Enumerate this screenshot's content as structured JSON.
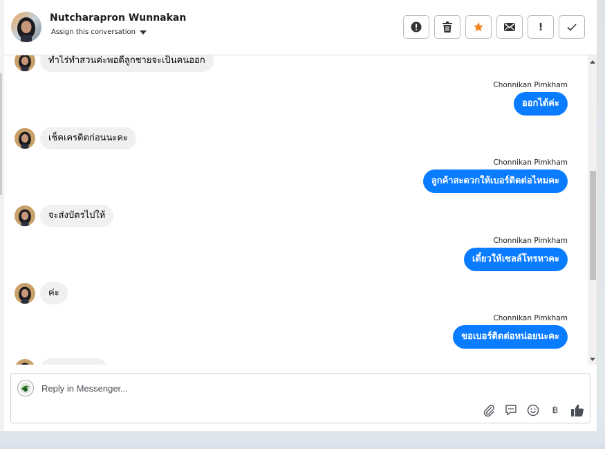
{
  "header": {
    "contact_name": "Nutcharapron Wunnakan",
    "assign_label": "Assign this conversation",
    "actions": [
      {
        "name": "spam",
        "icon": "alert-circle-icon"
      },
      {
        "name": "delete",
        "icon": "trash-icon"
      },
      {
        "name": "star",
        "icon": "star-icon",
        "color": "#f5821f"
      },
      {
        "name": "mark-unread",
        "icon": "envelope-icon"
      },
      {
        "name": "follow-up",
        "icon": "exclamation-icon",
        "glyph": "!"
      },
      {
        "name": "done",
        "icon": "check-icon"
      }
    ]
  },
  "messages": [
    {
      "direction": "in",
      "text": "ทำไร่ทำสวนค่ะพอดีลูกชายจะเป็นคนออก"
    },
    {
      "direction": "out",
      "sender": "Chonnikan Pimkham",
      "text": "ออกได้ค่ะ"
    },
    {
      "direction": "in",
      "text": "เช็คเครดิตก่อนนะคะ"
    },
    {
      "direction": "out",
      "sender": "Chonnikan Pimkham",
      "text": "ลูกค้าสะดวกให้เบอร์ติดต่อไหมคะ"
    },
    {
      "direction": "in",
      "text": "จะส่งบัตรไปให้"
    },
    {
      "direction": "out",
      "sender": "Chonnikan Pimkham",
      "text": "เดี๋ยวให้เซลล์โทรหาคะ"
    },
    {
      "direction": "in",
      "text": "ค่ะ"
    },
    {
      "direction": "out",
      "sender": "Chonnikan Pimkham",
      "text": "ขอเบอร์ติดต่อหน่อยนะคะ"
    }
  ],
  "composer": {
    "placeholder": "Reply in Messenger...",
    "baht_glyph": "฿",
    "tools": [
      "paperclip-icon",
      "chat-bubble-icon",
      "smiley-icon",
      "baht-icon",
      "thumbs-up-icon"
    ]
  },
  "colors": {
    "outgoing_bubble": "#0a7cff",
    "incoming_bubble": "#f0f0f0",
    "star": "#f5821f"
  }
}
